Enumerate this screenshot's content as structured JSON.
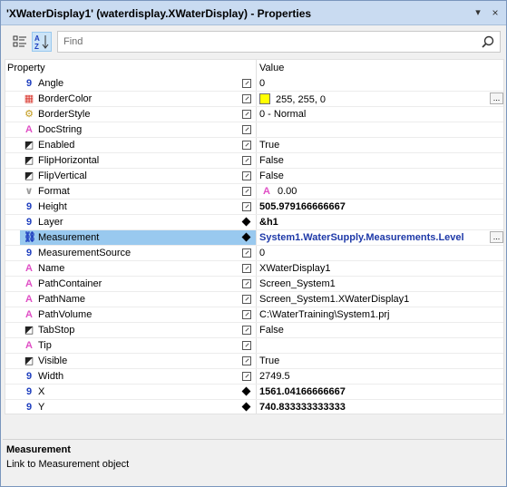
{
  "window": {
    "title": "'XWaterDisplay1' (waterdisplay.XWaterDisplay) - Properties",
    "pin_glyph": "▾",
    "close_glyph": "×"
  },
  "toolbar": {
    "search_placeholder": "Find",
    "categorized_icon": "categorized-icon",
    "alphabetical_icon": "sort-az-icon",
    "alphabetical_active": true
  },
  "grid": {
    "property_header": "Property",
    "value_header": "Value",
    "rows": [
      {
        "name": "Angle",
        "type": "number",
        "value": "0",
        "bold": false,
        "binding": false
      },
      {
        "name": "BorderColor",
        "type": "color",
        "value": "255, 255, 0",
        "swatch": "#ffff00",
        "ellipsis": true,
        "binding": false
      },
      {
        "name": "BorderStyle",
        "type": "enum",
        "value": "0 - Normal",
        "binding": false
      },
      {
        "name": "DocString",
        "type": "text",
        "value": "",
        "binding": false
      },
      {
        "name": "Enabled",
        "type": "bool",
        "value": "True",
        "binding": false
      },
      {
        "name": "FlipHorizontal",
        "type": "bool",
        "value": "False",
        "binding": false
      },
      {
        "name": "FlipVertical",
        "type": "bool",
        "value": "False",
        "binding": false
      },
      {
        "name": "Format",
        "type": "format",
        "value": "0.00",
        "format_glyph": "A",
        "binding": false
      },
      {
        "name": "Height",
        "type": "number",
        "value": "505.979166666667",
        "bold": true,
        "binding": false
      },
      {
        "name": "Layer",
        "type": "number",
        "value": "&h1",
        "bold": true,
        "binding": true
      },
      {
        "name": "Measurement",
        "type": "link",
        "value": "System1.WaterSupply.Measurements.Level",
        "link": true,
        "ellipsis": true,
        "binding": true,
        "selected": true
      },
      {
        "name": "MeasurementSource",
        "type": "number",
        "value": "0",
        "binding": false
      },
      {
        "name": "Name",
        "type": "text",
        "value": "XWaterDisplay1",
        "binding": false
      },
      {
        "name": "PathContainer",
        "type": "text",
        "value": "Screen_System1",
        "binding": false
      },
      {
        "name": "PathName",
        "type": "text",
        "value": "Screen_System1.XWaterDisplay1",
        "binding": false
      },
      {
        "name": "PathVolume",
        "type": "text",
        "value": "C:\\WaterTraining\\System1.prj",
        "binding": false
      },
      {
        "name": "TabStop",
        "type": "bool",
        "value": "False",
        "binding": false
      },
      {
        "name": "Tip",
        "type": "text",
        "value": "",
        "binding": false
      },
      {
        "name": "Visible",
        "type": "bool",
        "value": "True",
        "binding": false
      },
      {
        "name": "Width",
        "type": "number",
        "value": "2749.5",
        "binding": false
      },
      {
        "name": "X",
        "type": "number",
        "value": "1561.04166666667",
        "bold": true,
        "binding": true
      },
      {
        "name": "Y",
        "type": "number",
        "value": "740.833333333333",
        "bold": true,
        "binding": true
      }
    ]
  },
  "description": {
    "title": "Measurement",
    "text": "Link to Measurement object"
  },
  "colors": {
    "number_icon": "#1f3fbf",
    "text_icon": "#e04fc5",
    "selection": "#99c9ef",
    "link_value": "#1e39a8"
  }
}
